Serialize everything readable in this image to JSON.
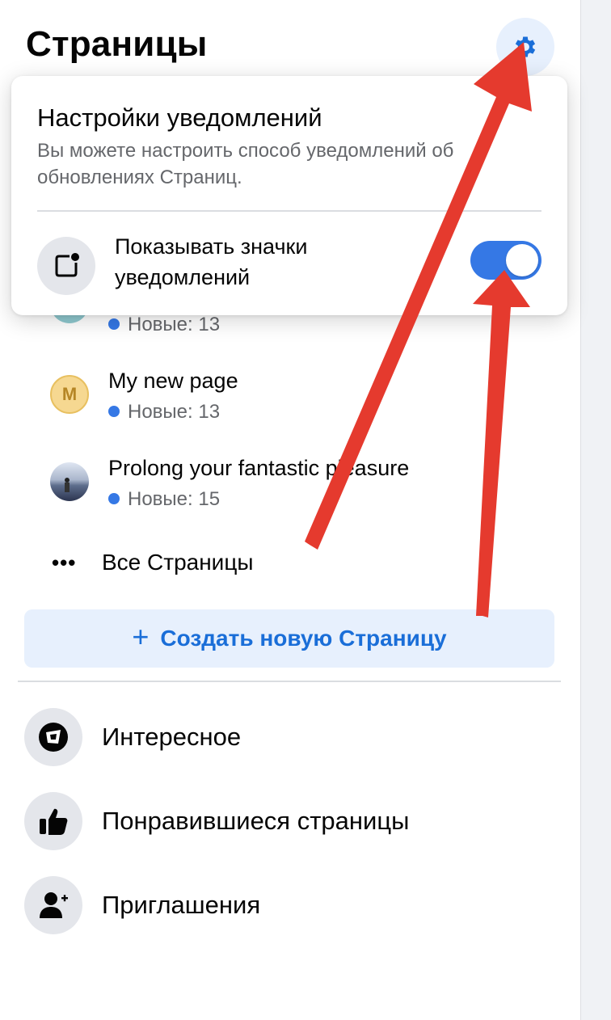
{
  "header": {
    "title": "Страницы",
    "settings_icon": "gear-icon"
  },
  "pages": [
    {
      "title": "",
      "new_label": "Новые: 13",
      "avatar": "teal-avatar"
    },
    {
      "title": "My new page",
      "new_label": "Новые: 13",
      "avatar_letter": "M"
    },
    {
      "title": "Prolong your fantastic pleasure",
      "new_label": "Новые: 15",
      "avatar": "photo-avatar"
    }
  ],
  "all_pages": {
    "icon": "more-dots-icon",
    "label": "Все Страницы"
  },
  "create_page": {
    "icon": "plus-icon",
    "label": "Создать новую Страницу"
  },
  "nav": [
    {
      "icon": "explore-icon",
      "label": "Интересное"
    },
    {
      "icon": "thumbs-up-icon",
      "label": "Понравившиеся страницы"
    },
    {
      "icon": "add-person-icon",
      "label": "Приглашения"
    }
  ],
  "notification_popup": {
    "title": "Настройки уведомлений",
    "description": "Вы можете настроить способ уведомлений об обновлениях Страниц.",
    "toggle_label": "Показывать значки уведомлений",
    "toggle_on": true,
    "badge_icon": "notification-badge-icon"
  },
  "colors": {
    "accent": "#1a6ed8",
    "toggle": "#3578e5",
    "new_dot": "#3578e5",
    "button_bg": "#e7f0fd",
    "annotation_arrow": "#e53a2e"
  }
}
